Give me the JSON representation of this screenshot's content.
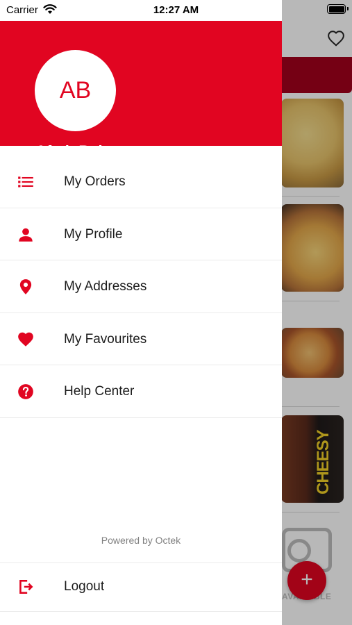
{
  "status_bar": {
    "carrier": "Carrier",
    "time": "12:27 AM"
  },
  "drawer": {
    "avatar_initials": "AB",
    "user_name": "Aftab Baig",
    "menu": [
      {
        "label": "My Orders",
        "icon": "list-icon"
      },
      {
        "label": "My Profile",
        "icon": "person-icon"
      },
      {
        "label": "My Addresses",
        "icon": "location-pin-icon"
      },
      {
        "label": "My Favourites",
        "icon": "heart-icon"
      },
      {
        "label": "Help Center",
        "icon": "help-circle-icon"
      }
    ],
    "powered_by": "Powered by Octek",
    "logout_label": "Logout"
  },
  "background": {
    "promo_text": "CHEESY",
    "image_placeholder_text": "AVAILABLE",
    "fab_label": "+"
  },
  "colors": {
    "accent": "#e10521",
    "drawer_background": "#ffffff",
    "text": "#1c1c1c",
    "muted_text": "#808080"
  }
}
